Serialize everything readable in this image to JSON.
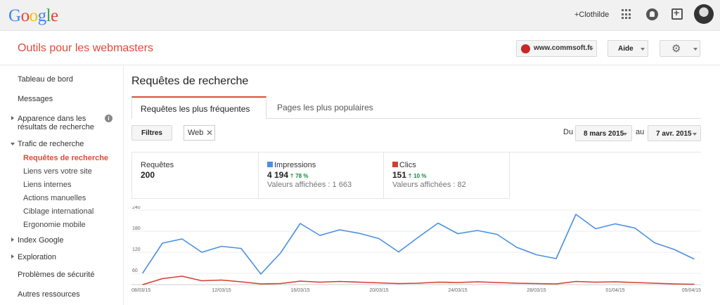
{
  "header": {
    "logo_letters": [
      "G",
      "o",
      "o",
      "g",
      "l",
      "e"
    ],
    "user_link": "+Clothilde",
    "icons": [
      "apps-icon",
      "notifications-icon",
      "share-icon",
      "avatar"
    ]
  },
  "subheader": {
    "app_title": "Outils pour les webmasters",
    "site_selector": "www.commsoft.fr",
    "help_label": "Aide",
    "settings_icon": "gear-icon"
  },
  "sidebar": {
    "dashboard": "Tableau de bord",
    "messages": "Messages",
    "appearance_line1": "Apparence dans les",
    "appearance_line2": "résultats de recherche",
    "search_traffic": "Trafic de recherche",
    "search_queries": "Requêtes de recherche",
    "links_to_site": "Liens vers votre site",
    "internal_links": "Liens internes",
    "manual_actions": "Actions manuelles",
    "international_targeting": "Ciblage international",
    "mobile_usability": "Ergonomie mobile",
    "google_index": "Index Google",
    "crawl": "Exploration",
    "security_issues": "Problèmes de sécurité",
    "other_resources": "Autres ressources"
  },
  "main": {
    "title": "Requêtes de recherche",
    "tabs": [
      "Requêtes les plus fréquentes",
      "Pages les plus populaires"
    ],
    "filters_label": "Filtres",
    "filter_chip": "Web",
    "date_from_label": "Du",
    "date_from": "8 mars 2015",
    "date_to_label": "au",
    "date_to": "7 avr. 2015",
    "metrics": {
      "queries_label": "Requêtes",
      "queries_value": "200",
      "impressions_label": "Impressions",
      "impressions_value": "4 194",
      "impressions_change": "78 %",
      "impressions_sub": "Valeurs affichées : 1 663",
      "clicks_label": "Clics",
      "clicks_value": "151",
      "clicks_change": "10 %",
      "clicks_sub": "Valeurs affichées : 82"
    }
  },
  "colors": {
    "accent_red": "#dd4b39",
    "impressions": "#4a90e2",
    "clicks": "#d23f31",
    "up_arrow": "#0a8a3a"
  },
  "chart_data": {
    "type": "line",
    "x": [
      "08/03/15",
      "09/03/15",
      "10/03/15",
      "11/03/15",
      "12/03/15",
      "13/03/15",
      "14/03/15",
      "15/03/15",
      "16/03/15",
      "17/03/15",
      "18/03/15",
      "19/03/15",
      "20/03/15",
      "21/03/15",
      "22/03/15",
      "23/03/15",
      "24/03/15",
      "25/03/15",
      "26/03/15",
      "27/03/15",
      "28/03/15",
      "29/03/15",
      "30/03/15",
      "31/03/15",
      "01/04/15",
      "02/04/15",
      "03/04/15",
      "04/04/15",
      "05/04/15"
    ],
    "xticks": [
      "08/03/15",
      "12/03/15",
      "16/03/15",
      "20/03/15",
      "24/03/15",
      "28/03/15",
      "01/04/15",
      "05/04/15"
    ],
    "yticks": [
      60,
      120,
      180,
      240
    ],
    "ylim": [
      28,
      252
    ],
    "series": [
      {
        "name": "Impressions",
        "color": "#4a90e2",
        "values": [
          61,
          146,
          158,
          120,
          137,
          131,
          58,
          118,
          202,
          168,
          184,
          174,
          159,
          121,
          163,
          203,
          173,
          182,
          171,
          134,
          113,
          102,
          228,
          187,
          201,
          189,
          147,
          128,
          101
        ]
      },
      {
        "name": "Clics",
        "color": "#d23f31",
        "values": [
          28,
          45,
          52,
          39,
          41,
          36,
          30,
          31,
          38,
          35,
          37,
          35,
          33,
          31,
          32,
          35,
          34,
          36,
          34,
          32,
          31,
          30,
          37,
          35,
          36,
          34,
          32,
          30,
          29
        ]
      }
    ]
  }
}
